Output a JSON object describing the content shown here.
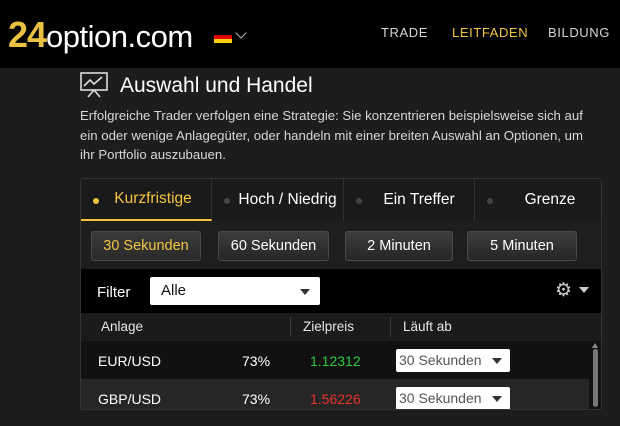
{
  "header": {
    "logo_number": "24",
    "logo_text": "option.com",
    "nav": [
      "TRADE",
      "LEITFADEN",
      "BILDUNG"
    ],
    "nav_active_index": 1
  },
  "section": {
    "title": "Auswahl und Handel",
    "description": "Erfolgreiche Trader verfolgen eine Strategie: Sie konzentrieren beispielsweise sich auf ein oder wenige Anlagegüter, oder handeln mit einer breiten Auswahl an Optionen, um ihr Portfolio auszubauen."
  },
  "tabs": [
    "Kurzfristige",
    "Hoch / Niedrig",
    "Ein Treffer",
    "Grenze"
  ],
  "active_tab_index": 0,
  "time_buttons": [
    "30 Sekunden",
    "60 Sekunden",
    "2 Minuten",
    "5 Minuten"
  ],
  "active_time_index": 0,
  "filter": {
    "label": "Filter",
    "value": "Alle"
  },
  "columns": {
    "asset": "Anlage",
    "target": "Zielpreis",
    "expiry": "Läuft ab"
  },
  "rows": [
    {
      "asset": "EUR/USD",
      "percent": "73%",
      "price": "1.12312",
      "price_color": "#2ecc40",
      "expiry": "30 Sekunden"
    },
    {
      "asset": "GBP/USD",
      "percent": "73%",
      "price": "1.56226",
      "price_color": "#e8322c",
      "expiry": "30 Sekunden"
    }
  ],
  "colors": {
    "accent": "#f4c542",
    "background": "#1d1d1d",
    "up": "#2ecc40",
    "down": "#e8322c"
  }
}
